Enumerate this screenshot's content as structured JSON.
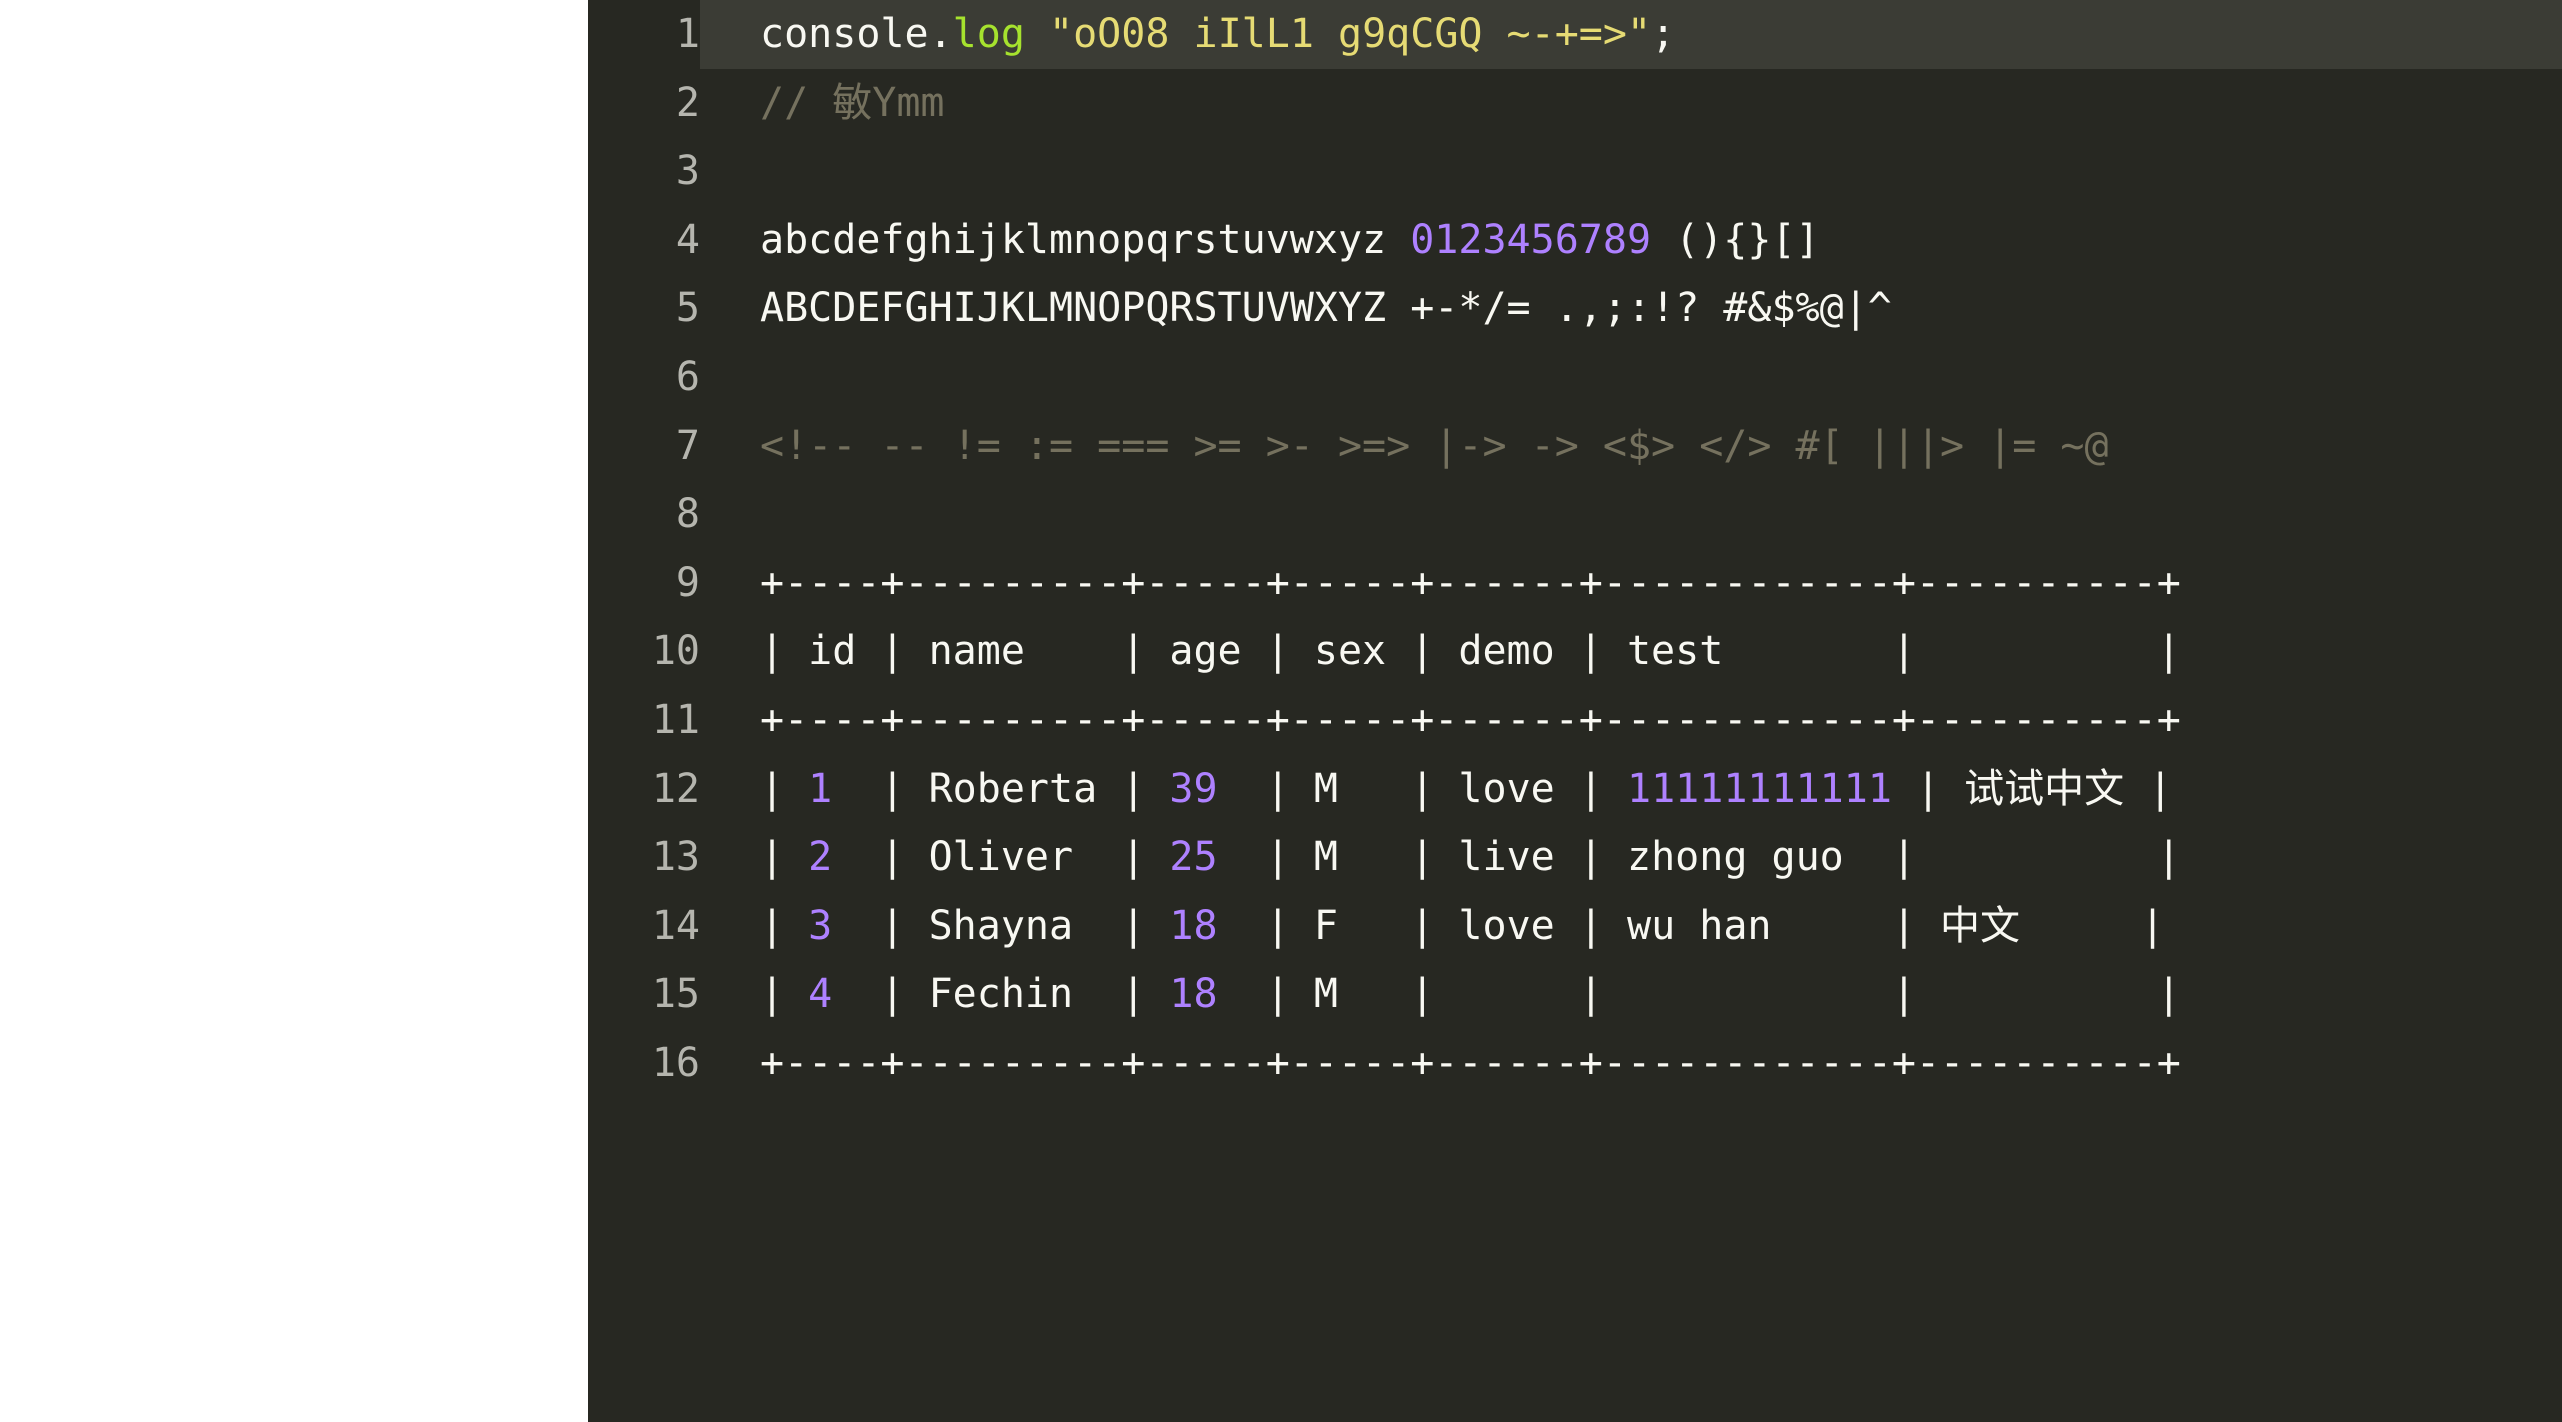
{
  "editor": {
    "theme": {
      "background": "#272822",
      "gutter_text": "#b5b5ae",
      "active_line_background": "#3b3c35",
      "foreground": "#f8f8f2",
      "keyword": "#a6e22e",
      "string": "#e6db74",
      "number": "#ae81ff",
      "comment": "#75715e",
      "page_background": "#ffffff"
    },
    "lines": [
      {
        "number": "1",
        "active": true,
        "tokens": [
          {
            "text": "console.",
            "type": "plain"
          },
          {
            "text": "log",
            "type": "keyword"
          },
          {
            "text": " ",
            "type": "plain"
          },
          {
            "text": "\"oO08 iIlL1 g9qCGQ ~-+=>\"",
            "type": "string"
          },
          {
            "text": ";",
            "type": "plain"
          }
        ]
      },
      {
        "number": "2",
        "active": false,
        "tokens": [
          {
            "text": "// 敏Ymm",
            "type": "comment"
          }
        ]
      },
      {
        "number": "3",
        "active": false,
        "tokens": []
      },
      {
        "number": "4",
        "active": false,
        "tokens": [
          {
            "text": "abcdefghijklmnopqrstuvwxyz ",
            "type": "plain"
          },
          {
            "text": "0123456789",
            "type": "number"
          },
          {
            "text": " (){}[]",
            "type": "plain"
          }
        ]
      },
      {
        "number": "5",
        "active": false,
        "tokens": [
          {
            "text": "ABCDEFGHIJKLMNOPQRSTUVWXYZ +-*/= .,;:!? #&$%@|^",
            "type": "plain"
          }
        ]
      },
      {
        "number": "6",
        "active": false,
        "tokens": []
      },
      {
        "number": "7",
        "active": false,
        "tokens": [
          {
            "text": "<!-- -- != := === >= >- >=> |-> -> <$> </> #[ |||> |= ~@",
            "type": "comment"
          }
        ]
      },
      {
        "number": "8",
        "active": false,
        "tokens": []
      },
      {
        "number": "9",
        "active": false,
        "tokens": [
          {
            "text": "+----+---------+-----+-----+------+------------+----------+",
            "type": "plain"
          }
        ]
      },
      {
        "number": "10",
        "active": false,
        "tokens": [
          {
            "text": "| id | name    | age | sex | demo | test       |          |",
            "type": "plain"
          }
        ]
      },
      {
        "number": "11",
        "active": false,
        "tokens": [
          {
            "text": "+----+---------+-----+-----+------+------------+----------+",
            "type": "plain"
          }
        ]
      },
      {
        "number": "12",
        "active": false,
        "tokens": [
          {
            "text": "| ",
            "type": "plain"
          },
          {
            "text": "1",
            "type": "number"
          },
          {
            "text": "  | Roberta | ",
            "type": "plain"
          },
          {
            "text": "39",
            "type": "number"
          },
          {
            "text": "  | M   | love | ",
            "type": "plain"
          },
          {
            "text": "11111111111",
            "type": "number"
          },
          {
            "text": " | 试试中文 |",
            "type": "plain"
          }
        ]
      },
      {
        "number": "13",
        "active": false,
        "tokens": [
          {
            "text": "| ",
            "type": "plain"
          },
          {
            "text": "2",
            "type": "number"
          },
          {
            "text": "  | Oliver  | ",
            "type": "plain"
          },
          {
            "text": "25",
            "type": "number"
          },
          {
            "text": "  | M   | live | zhong guo  |          |",
            "type": "plain"
          }
        ]
      },
      {
        "number": "14",
        "active": false,
        "tokens": [
          {
            "text": "| ",
            "type": "plain"
          },
          {
            "text": "3",
            "type": "number"
          },
          {
            "text": "  | Shayna  | ",
            "type": "plain"
          },
          {
            "text": "18",
            "type": "number"
          },
          {
            "text": "  | F   | love | wu han     | 中文     |",
            "type": "plain"
          }
        ]
      },
      {
        "number": "15",
        "active": false,
        "tokens": [
          {
            "text": "| ",
            "type": "plain"
          },
          {
            "text": "4",
            "type": "number"
          },
          {
            "text": "  | Fechin  | ",
            "type": "plain"
          },
          {
            "text": "18",
            "type": "number"
          },
          {
            "text": "  | M   |      |            |          |",
            "type": "plain"
          }
        ]
      },
      {
        "number": "16",
        "active": false,
        "tokens": [
          {
            "text": "+----+---------+-----+-----+------+------------+----------+",
            "type": "plain"
          }
        ]
      }
    ],
    "table_preview": {
      "columns": [
        "id",
        "name",
        "age",
        "sex",
        "demo",
        "test",
        ""
      ],
      "rows": [
        [
          "1",
          "Roberta",
          "39",
          "M",
          "love",
          "11111111111",
          "试试中文"
        ],
        [
          "2",
          "Oliver",
          "25",
          "M",
          "live",
          "zhong guo",
          ""
        ],
        [
          "3",
          "Shayna",
          "18",
          "F",
          "love",
          "wu han",
          "中文"
        ],
        [
          "4",
          "Fechin",
          "18",
          "M",
          "",
          "",
          ""
        ]
      ]
    }
  }
}
